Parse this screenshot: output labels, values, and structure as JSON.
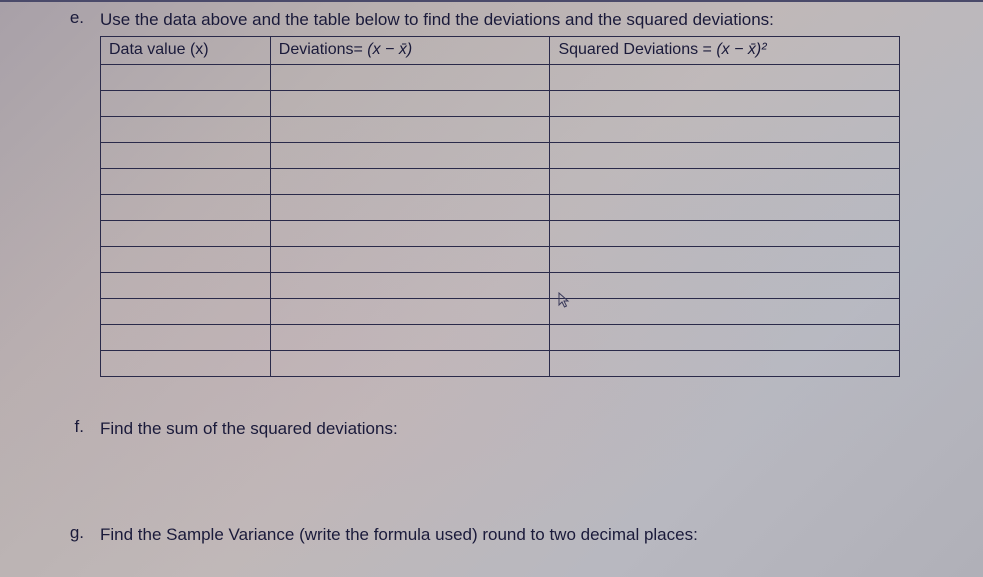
{
  "questions": {
    "e": {
      "label": "e.",
      "text": "Use the data above and the table below to find the deviations and the squared deviations:"
    },
    "f": {
      "label": "f.",
      "text": "Find the sum of the squared deviations:"
    },
    "g": {
      "label": "g.",
      "text": "Find the Sample Variance (write the formula used) round to two decimal places:"
    }
  },
  "table": {
    "headers": {
      "data_value": "Data value (x)",
      "deviations_prefix": "Deviations= ",
      "deviations_formula": "(x − x̄)",
      "squared_prefix": "Squared Deviations = ",
      "squared_formula": "(x − x̄)²"
    },
    "num_rows": 12
  }
}
